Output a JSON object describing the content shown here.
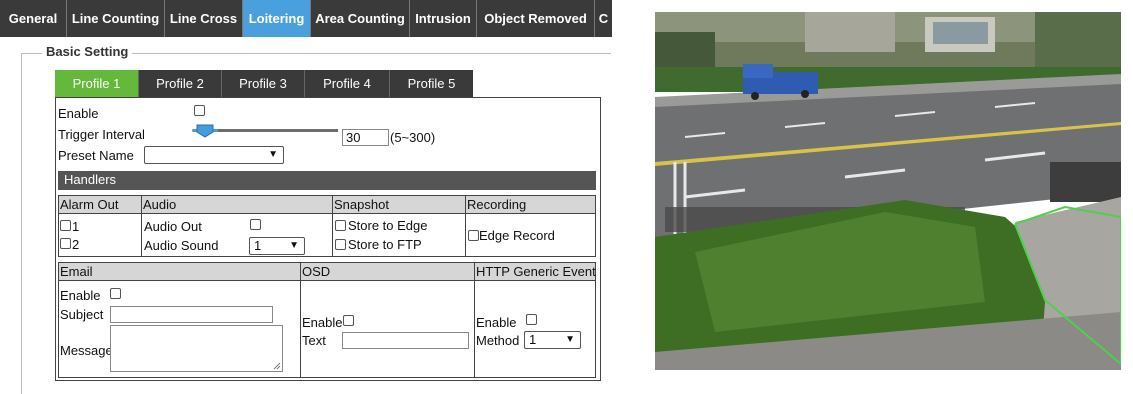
{
  "tabs": [
    "General",
    "Line Counting",
    "Line Cross",
    "Loitering",
    "Area Counting",
    "Intrusion",
    "Object Removed",
    "C"
  ],
  "active_tab": "Loitering",
  "basic_setting": {
    "legend": "Basic Setting",
    "profiles": [
      "Profile 1",
      "Profile 2",
      "Profile 3",
      "Profile 4",
      "Profile 5"
    ],
    "active_profile": "Profile 1",
    "enable_label": "Enable",
    "trigger_interval_label": "Trigger Interval",
    "trigger_interval_value": "30",
    "trigger_interval_range": "(5~300)",
    "preset_name_label": "Preset Name",
    "preset_name_value": ""
  },
  "handlers": {
    "title": "Handlers",
    "alarm_out": {
      "header": "Alarm Out",
      "items": [
        "1",
        "2"
      ]
    },
    "audio": {
      "header": "Audio",
      "audio_out_label": "Audio Out",
      "audio_sound_label": "Audio Sound",
      "audio_sound_value": "1"
    },
    "snapshot": {
      "header": "Snapshot",
      "store_edge": "Store to Edge",
      "store_ftp": "Store to FTP"
    },
    "recording": {
      "header": "Recording",
      "edge_record": "Edge Record"
    }
  },
  "email": {
    "header": "Email",
    "enable_label": "Enable",
    "subject_label": "Subject",
    "message_label": "Message"
  },
  "osd": {
    "header": "OSD",
    "enable_label": "Enable",
    "text_label": "Text"
  },
  "http_event": {
    "header": "HTTP Generic Event",
    "enable_label": "Enable",
    "method_label": "Method",
    "method_value": "1"
  },
  "colors": {
    "tab_bg": "#3a3a3a",
    "active_tab": "#4aa0dd",
    "active_profile": "#64b83a",
    "roi_polygon": "#4cd14c"
  }
}
